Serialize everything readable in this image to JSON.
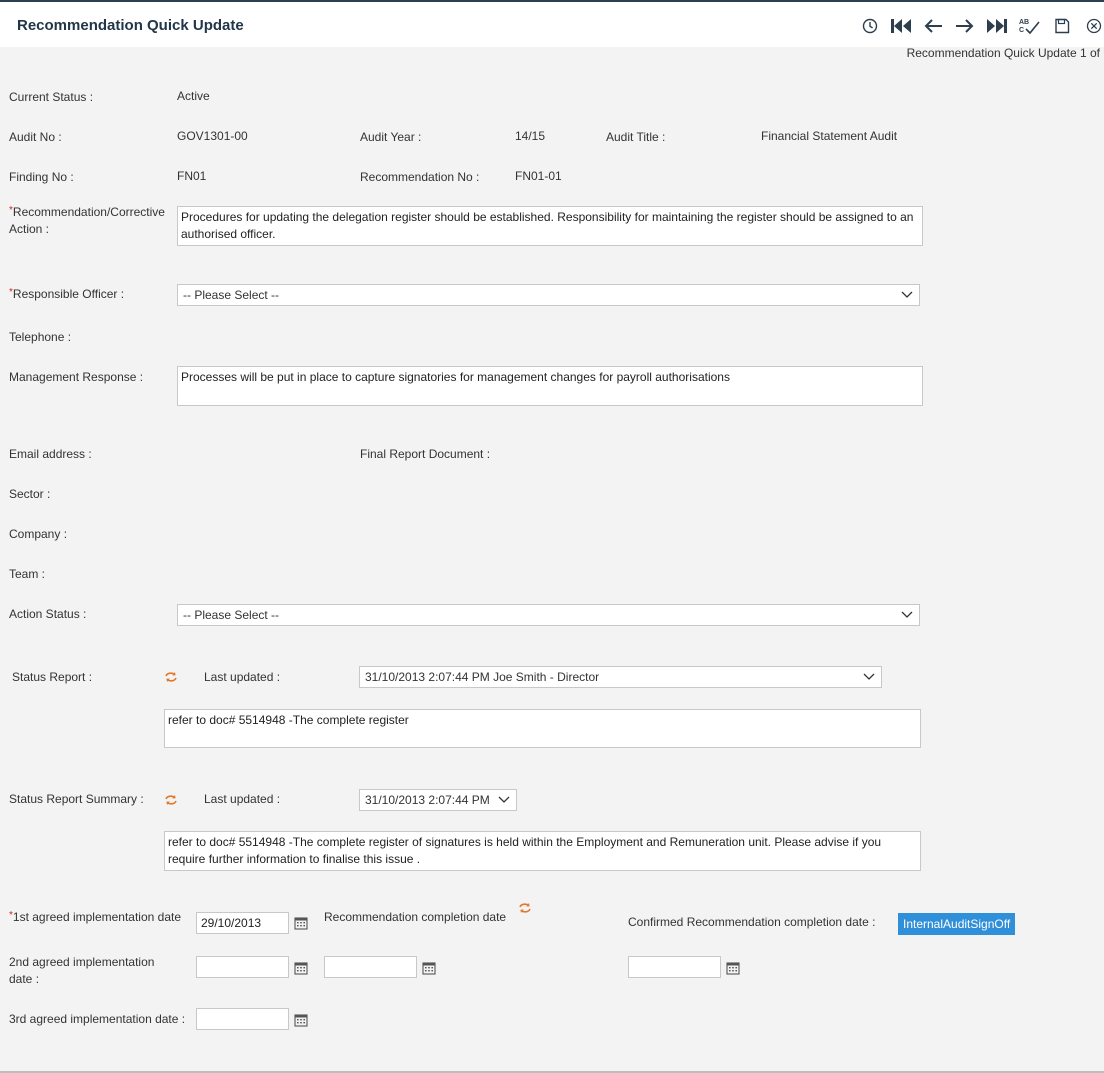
{
  "title": "Recommendation Quick Update",
  "pager_text": "Recommendation Quick Update 1 of",
  "toolbar": {
    "icons": [
      "history-icon",
      "first-record-icon",
      "previous-icon",
      "next-icon",
      "last-record-icon",
      "spellcheck-icon",
      "save-icon",
      "close-icon"
    ]
  },
  "fields": {
    "current_status_label": "Current Status :",
    "current_status_value": "Active",
    "audit_no_label": "Audit No :",
    "audit_no_value": "GOV1301-00",
    "audit_year_label": "Audit Year :",
    "audit_year_value": "14/15",
    "audit_title_label": "Audit Title :",
    "audit_title_value": "Financial Statement Audit",
    "finding_no_label": "Finding No :",
    "finding_no_value": "FN01",
    "recommendation_no_label": "Recommendation No :",
    "recommendation_no_value": "FN01-01",
    "recommendation_label_line1": "Recommendation/Corrective",
    "recommendation_label_line2": "Action :",
    "recommendation_value": "Procedures for updating the delegation register should be established. Responsibility for maintaining the register should be assigned to an authorised officer.",
    "responsible_officer_label": "Responsible Officer :",
    "responsible_officer_value": "-- Please Select --",
    "telephone_label": "Telephone :",
    "management_response_label": "Management Response :",
    "management_response_value": "Processes will be put in place to capture signatories for management changes for payroll authorisations",
    "email_label": "Email address :",
    "final_report_label": "Final Report Document :",
    "sector_label": "Sector :",
    "company_label": "Company :",
    "team_label": "Team :",
    "action_status_label": "Action Status :",
    "action_status_value": "-- Please Select --",
    "status_report_label": "Status Report :",
    "last_updated_label": "Last updated :",
    "status_report_last_updated": "31/10/2013 2:07:44 PM Joe Smith - Director",
    "status_report_value": "refer to doc# 5514948  -The complete register",
    "status_summary_label": "Status Report Summary :",
    "status_summary_last_updated": "31/10/2013 2:07:44 PM",
    "status_summary_value": "refer to doc# 5514948  -The complete register of signatures is held within the Employment and Remuneration unit. Please advise if you require further information to finalise this issue .",
    "first_date_label": "1st agreed implementation date",
    "first_date_value": "29/10/2013",
    "rec_completion_label": "Recommendation completion date",
    "confirmed_completion_label": "Confirmed Recommendation completion date :",
    "signoff_button": "InternalAuditSignOff",
    "second_date_label_line1": "2nd agreed implementation",
    "second_date_label_line2": "date :",
    "third_date_label": "3rd agreed implementation date :"
  },
  "colors": {
    "title": "#22364a",
    "required": "#d9251c",
    "button": "#2f8fd8",
    "refresh_icon": "#e2772a"
  }
}
